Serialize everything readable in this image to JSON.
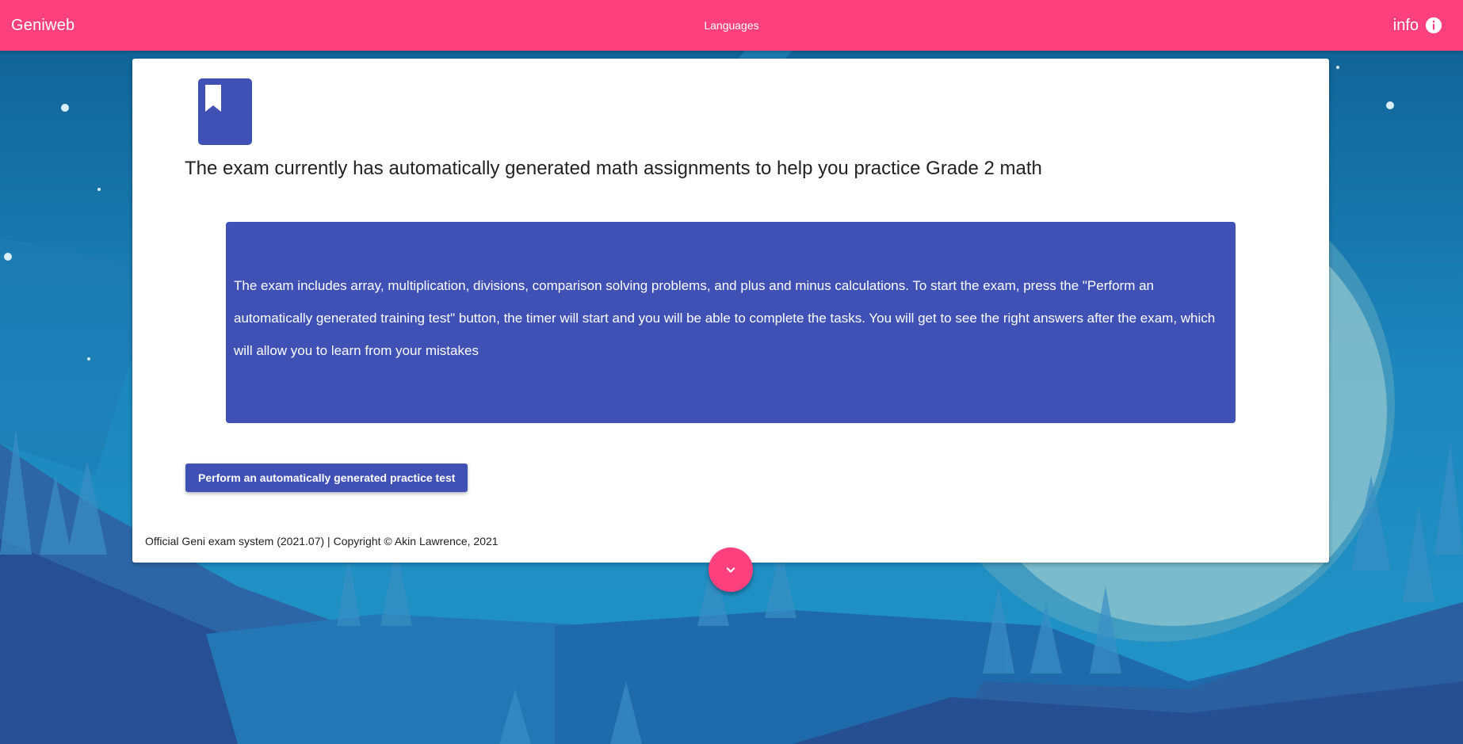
{
  "colors": {
    "appbar": "#ff407e",
    "primary": "#3f51b5",
    "fab": "#ff407e",
    "card": "#ffffff",
    "sky": "#1b75ad"
  },
  "appbar": {
    "brand": "Geniweb",
    "languages_label": "Languages",
    "info_label": "info",
    "info_icon": "info-circle-icon"
  },
  "card": {
    "icon": "book-bookmark-icon",
    "headline": "The exam currently has automatically generated math assignments to help you practice Grade 2 math",
    "description": "The exam includes array, multiplication, divisions, comparison solving problems, and plus and minus calculations. To start the exam, press the \"Perform an automatically generated training test\" button, the timer will start and you will be able to complete the tasks. You will get to see the right answers after the exam, which will allow you to learn from your mistakes",
    "start_button_label": "Perform an automatically generated practice test",
    "footer": "Official Geni exam system (2021.07) | Copyright © Akin Lawrence, 2021"
  },
  "fab": {
    "icon": "chevron-down-icon"
  }
}
